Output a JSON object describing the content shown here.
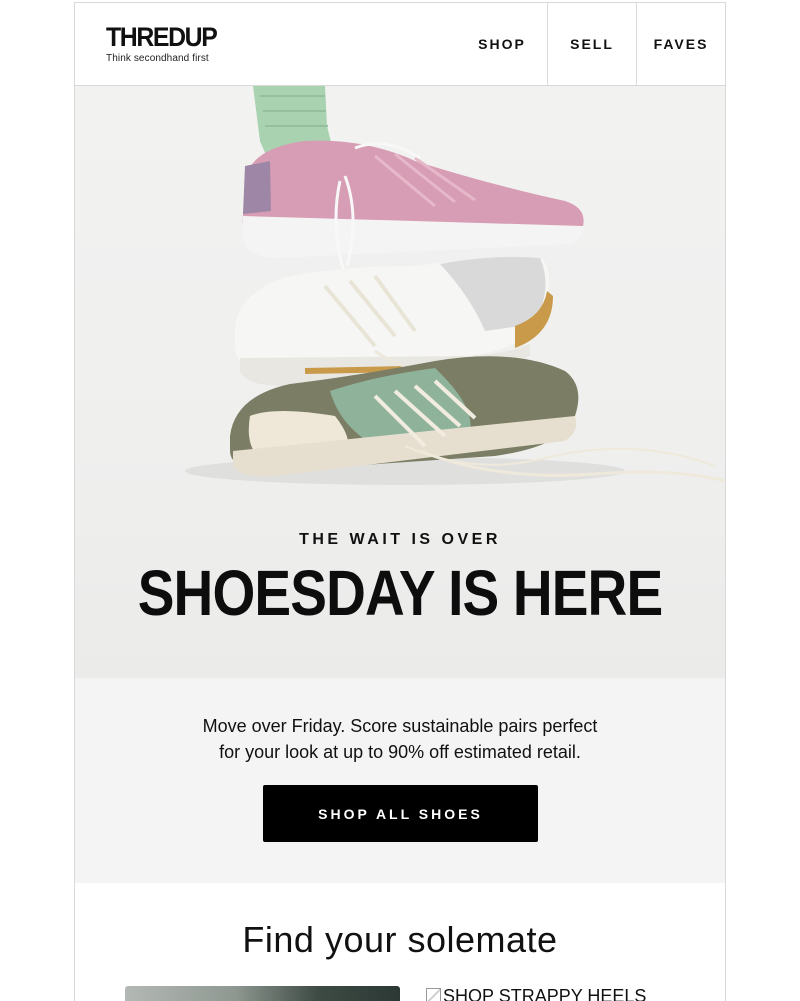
{
  "brand": {
    "name": "THREDUP",
    "tagline": "Think secondhand first"
  },
  "nav": {
    "shop": "SHOP",
    "sell": "SELL",
    "faves": "FAVES"
  },
  "hero": {
    "kicker": "THE WAIT IS OVER",
    "title": "SHOESDAY IS HERE"
  },
  "promo": {
    "line1": "Move over Friday. Score sustainable pairs perfect",
    "line2": "for your look at up to 90% off estimated retail.",
    "cta": "SHOP ALL SHOES"
  },
  "section": {
    "title": "Find your solemate",
    "tile_right_alt": "SHOP STRAPPY HEELS"
  },
  "colors": {
    "accent": "#000000",
    "sock": "#a9d2b0",
    "pink_shoe": "#d79db4",
    "green_shoe": "#8fb39a",
    "olive": "#7b7d64"
  },
  "icons": {
    "broken_image": "broken-image-icon"
  }
}
